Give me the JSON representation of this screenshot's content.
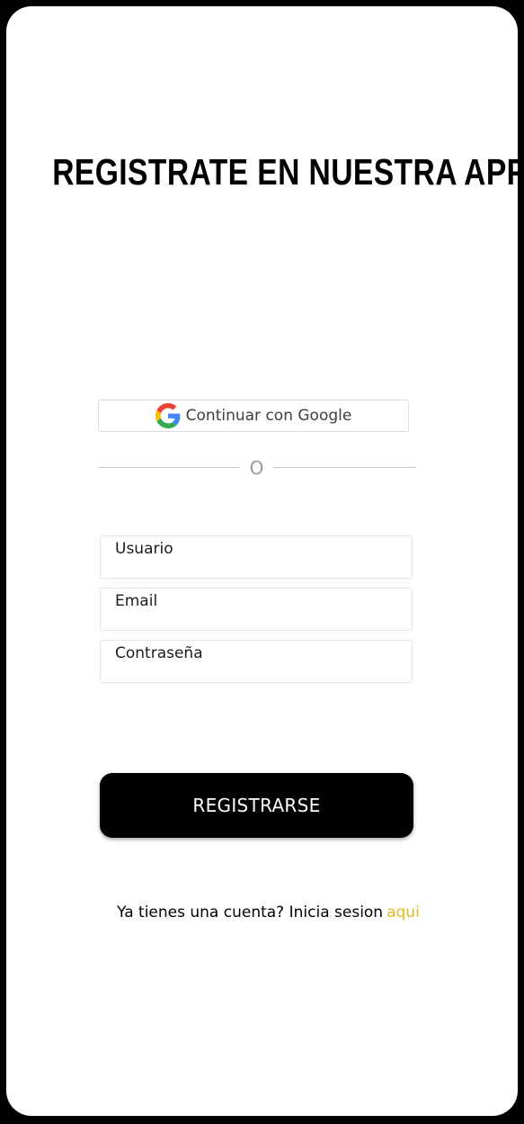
{
  "page": {
    "title": "REGISTRATE EN NUESTRA APP"
  },
  "google_button": {
    "label": "Continuar con Google",
    "icon": "google-g-icon"
  },
  "divider": {
    "text": "O"
  },
  "form": {
    "username_placeholder": "Usuario",
    "email_placeholder": "Email",
    "password_placeholder": "Contraseña",
    "submit_label": "REGISTRARSE"
  },
  "login_prompt": {
    "text": "Ya tienes una cuenta? Inicia sesion",
    "link_label": "aqui"
  },
  "colors": {
    "background": "#ffffff",
    "frame": "#000000",
    "primary_button": "#000000",
    "link": "#e8b820"
  }
}
